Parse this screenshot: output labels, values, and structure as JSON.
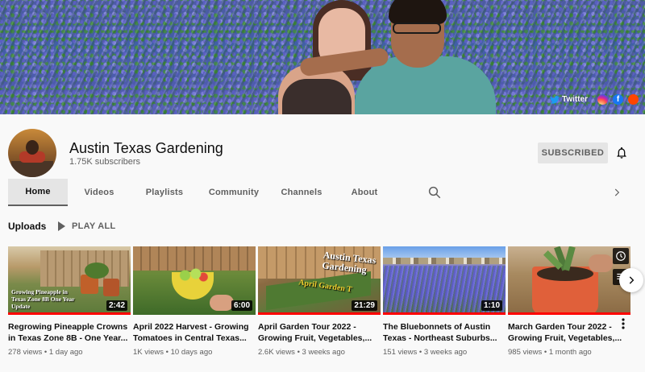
{
  "banner": {
    "links": [
      {
        "label": "Twitter",
        "icon": "twitter-icon",
        "color": "#1d9bf0"
      },
      {
        "label": "",
        "icon": "instagram-icon",
        "color": "#d6249f"
      },
      {
        "label": "",
        "icon": "facebook-icon",
        "color": "#1877f2"
      },
      {
        "label": "",
        "icon": "reddit-icon",
        "color": "#ff4500"
      }
    ]
  },
  "channel": {
    "name": "Austin Texas Gardening",
    "subscribers": "1.75K subscribers",
    "subscribe_label": "SUBSCRIBED"
  },
  "tabs": [
    {
      "label": "Home",
      "active": true
    },
    {
      "label": "Videos",
      "active": false
    },
    {
      "label": "Playlists",
      "active": false
    },
    {
      "label": "Community",
      "active": false
    },
    {
      "label": "Channels",
      "active": false
    },
    {
      "label": "About",
      "active": false
    }
  ],
  "shelf": {
    "title": "Uploads",
    "play_all": "PLAY ALL"
  },
  "videos": [
    {
      "title": "Regrowing Pineapple Crowns in Texas Zone 8B - One Year...",
      "duration": "2:42",
      "views": "278 views",
      "age": "1 day ago",
      "overlay": "Growing Pineapple in Texas Zone 8B One Year Update",
      "progress": 1.0
    },
    {
      "title": "April 2022 Harvest - Growing Tomatoes in Central Texas...",
      "duration": "6:00",
      "views": "1K views",
      "age": "10 days ago",
      "overlay": "",
      "progress": 0
    },
    {
      "title": "April Garden Tour 2022 - Growing Fruit, Vegetables,...",
      "duration": "21:29",
      "views": "2.6K views",
      "age": "3 weeks ago",
      "overlay": "Austin Texas Gardening",
      "overlay2": "April Garden T",
      "progress": 1.0
    },
    {
      "title": "The Bluebonnets of Austin Texas - Northeast Suburbs...",
      "duration": "1:10",
      "views": "151 views",
      "age": "3 weeks ago",
      "overlay": "",
      "progress": 1.0
    },
    {
      "title": "March Garden Tour 2022 - Growing Fruit, Vegetables,...",
      "duration": "",
      "views": "985 views",
      "age": "1 month ago",
      "overlay": "",
      "progress": 1.0
    }
  ],
  "meta_sep": " • "
}
